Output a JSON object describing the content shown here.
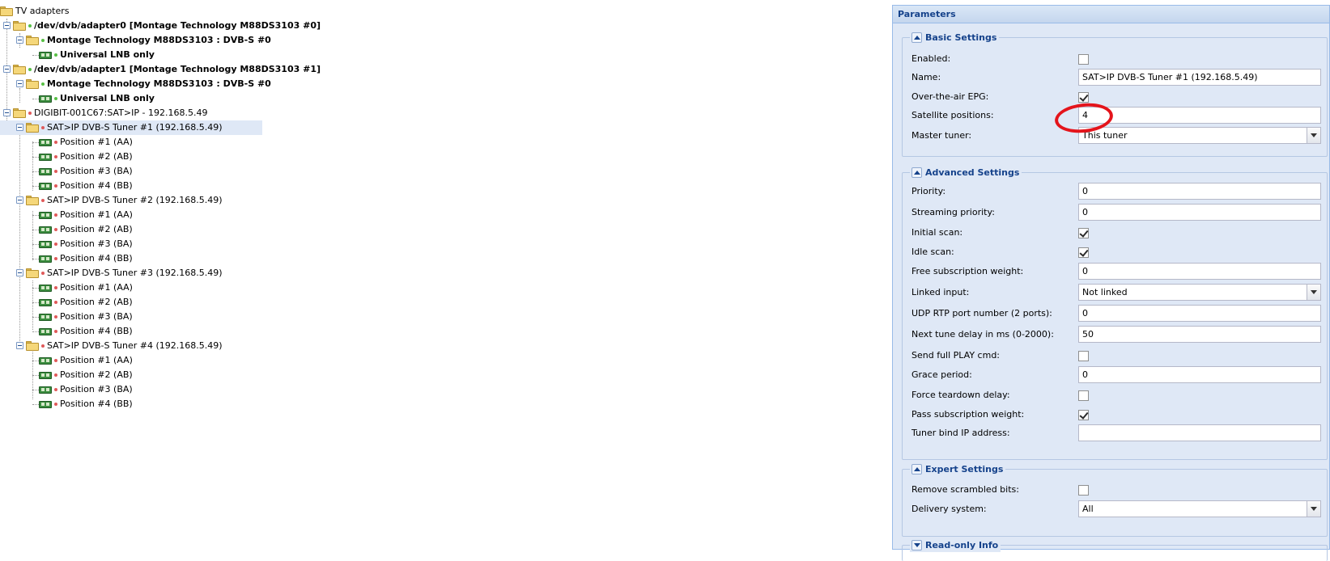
{
  "tree": {
    "root": "TV adapters",
    "adapter0": {
      "label": "/dev/dvb/adapter0 [Montage Technology M88DS3103 #0]",
      "frontend": "Montage Technology M88DS3103 : DVB-S #0",
      "lnb": "Universal LNB only"
    },
    "adapter1": {
      "label": "/dev/dvb/adapter1 [Montage Technology M88DS3103 #1]",
      "frontend": "Montage Technology M88DS3103 : DVB-S #0",
      "lnb": "Universal LNB only"
    },
    "satip": {
      "label": "DIGIBIT-001C67:SAT>IP - 192.168.5.49",
      "tuners": [
        {
          "label": "SAT>IP DVB-S Tuner #1 (192.168.5.49)",
          "positions": [
            "Position #1 (AA)",
            "Position #2 (AB)",
            "Position #3 (BA)",
            "Position #4 (BB)"
          ]
        },
        {
          "label": "SAT>IP DVB-S Tuner #2 (192.168.5.49)",
          "positions": [
            "Position #1 (AA)",
            "Position #2 (AB)",
            "Position #3 (BA)",
            "Position #4 (BB)"
          ]
        },
        {
          "label": "SAT>IP DVB-S Tuner #3 (192.168.5.49)",
          "positions": [
            "Position #1 (AA)",
            "Position #2 (AB)",
            "Position #3 (BA)",
            "Position #4 (BB)"
          ]
        },
        {
          "label": "SAT>IP DVB-S Tuner #4 (192.168.5.49)",
          "positions": [
            "Position #1 (AA)",
            "Position #2 (AB)",
            "Position #3 (BA)",
            "Position #4 (BB)"
          ]
        }
      ]
    }
  },
  "params": {
    "title": "Parameters",
    "basic": {
      "legend": "Basic Settings",
      "enabled_label": "Enabled:",
      "enabled": false,
      "name_label": "Name:",
      "name_value": "SAT>IP DVB-S Tuner #1 (192.168.5.49)",
      "epg_label": "Over-the-air EPG:",
      "epg": true,
      "satpos_label": "Satellite positions:",
      "satpos_value": "4",
      "master_label": "Master tuner:",
      "master_value": "This tuner"
    },
    "advanced": {
      "legend": "Advanced Settings",
      "priority_label": "Priority:",
      "priority_value": "0",
      "streaming_label": "Streaming priority:",
      "streaming_value": "0",
      "initial_scan_label": "Initial scan:",
      "initial_scan": true,
      "idle_scan_label": "Idle scan:",
      "idle_scan": true,
      "free_sub_label": "Free subscription weight:",
      "free_sub_value": "0",
      "linked_label": "Linked input:",
      "linked_value": "Not linked",
      "udp_label": "UDP RTP port number (2 ports):",
      "udp_value": "0",
      "tune_delay_label": "Next tune delay in ms (0-2000):",
      "tune_delay_value": "50",
      "full_play_label": "Send full PLAY cmd:",
      "full_play": false,
      "grace_label": "Grace period:",
      "grace_value": "0",
      "teardown_label": "Force teardown delay:",
      "teardown": false,
      "pass_sub_label": "Pass subscription weight:",
      "pass_sub": true,
      "bind_ip_label": "Tuner bind IP address:",
      "bind_ip_value": ""
    },
    "expert": {
      "legend": "Expert Settings",
      "scrambled_label": "Remove scrambled bits:",
      "scrambled": false,
      "delivery_label": "Delivery system:",
      "delivery_value": "All"
    },
    "readonly": {
      "legend": "Read-only Info"
    }
  },
  "colors": {
    "panel_bg": "#dfe8f6",
    "header_text": "#15428b",
    "annotation": "#e4141b",
    "status_green": "#58c045",
    "status_red": "#e05a5a"
  }
}
